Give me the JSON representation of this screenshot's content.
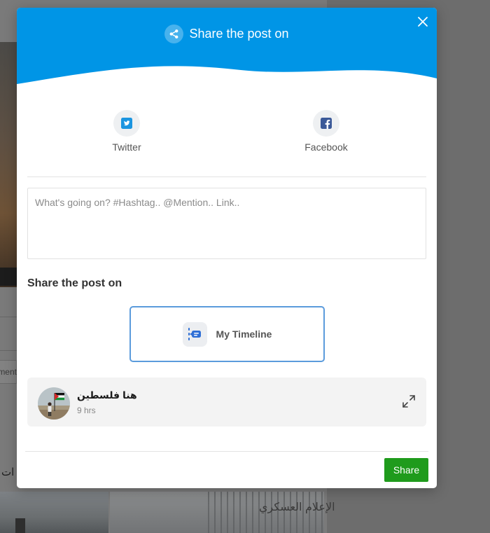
{
  "modal": {
    "title": "Share the post on",
    "header_color": "#0095e6",
    "icons": {
      "title": "share-icon",
      "close": "close-icon"
    }
  },
  "social": {
    "twitter": {
      "label": "Twitter",
      "icon": "twitter-icon"
    },
    "facebook": {
      "label": "Facebook",
      "icon": "facebook-icon"
    }
  },
  "composer": {
    "placeholder": "What's going on? #Hashtag.. @Mention.. Link..",
    "value": ""
  },
  "share_section": {
    "heading": "Share the post on",
    "option_label": "My Timeline",
    "option_icon": "timeline-icon",
    "selected_border_color": "#5b9bdc"
  },
  "post_preview": {
    "author": "هنا فلسطين",
    "time": "9 hrs",
    "expand_icon": "expand-icon"
  },
  "footer": {
    "share_label": "Share",
    "share_color": "#1f9b1c"
  },
  "background": {
    "comment_placeholder": "ment",
    "arabic_fragment": "ات",
    "watermark_text": "الإعلام العسكري"
  }
}
